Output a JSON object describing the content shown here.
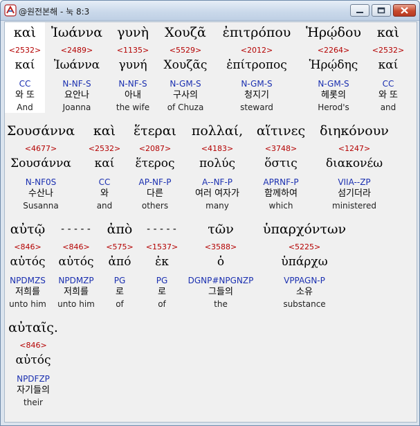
{
  "window": {
    "title": "@원전본해 - 눅 8:3"
  },
  "rows": [
    {
      "words": [
        {
          "greek": "καὶ",
          "strong": "<2532>",
          "lemma": "καί",
          "parse": "CC",
          "korean": "와 또",
          "english": "And"
        },
        {
          "greek": "Ἰωάννα",
          "strong": "<2489>",
          "lemma": "Ἰωάννα",
          "parse": "N-NF-S",
          "korean": "요안나",
          "english": "Joanna"
        },
        {
          "greek": "γυνὴ",
          "strong": "<1135>",
          "lemma": "γυνή",
          "parse": "N-NF-S",
          "korean": "아내",
          "english": "the wife"
        },
        {
          "greek": "Χουζᾶ",
          "strong": "<5529>",
          "lemma": "Χουζᾶς",
          "parse": "N-GM-S",
          "korean": "구사의",
          "english": "of Chuza"
        },
        {
          "greek": "ἐπιτρόπου",
          "strong": "<2012>",
          "lemma": "ἐπίτροπος",
          "parse": "N-GM-S",
          "korean": "청지기",
          "english": "steward"
        },
        {
          "greek": "Ἡρῴδου",
          "strong": "<2264>",
          "lemma": "Ἡρῴδης",
          "parse": "N-GM-S",
          "korean": "헤롯의",
          "english": "Herod's"
        },
        {
          "greek": "καὶ",
          "strong": "<2532>",
          "lemma": "καί",
          "parse": "CC",
          "korean": "와 또",
          "english": "and"
        }
      ]
    },
    {
      "words": [
        {
          "greek": "Σουσάννα",
          "strong": "<4677>",
          "lemma": "Σουσάννα",
          "parse": "N-NF0S",
          "korean": "수산나",
          "english": "Susanna"
        },
        {
          "greek": "καὶ",
          "strong": "<2532>",
          "lemma": "καί",
          "parse": "CC",
          "korean": "와",
          "english": "and"
        },
        {
          "greek": "ἕτεραι",
          "strong": "<2087>",
          "lemma": "ἕτερος",
          "parse": "AP-NF-P",
          "korean": "다른",
          "english": "others"
        },
        {
          "greek": "πολλαί,",
          "strong": "<4183>",
          "lemma": "πολύς",
          "parse": "A--NF-P",
          "korean": "여러 여자가",
          "english": "many"
        },
        {
          "greek": "αἵτινες",
          "strong": "<3748>",
          "lemma": "ὅστις",
          "parse": "APRNF-P",
          "korean": "함께하여",
          "english": "which"
        },
        {
          "greek": "διηκόνουν",
          "strong": "<1247>",
          "lemma": "διακονέω",
          "parse": "VIIA--ZP",
          "korean": "섬기더라",
          "english": "ministered"
        }
      ]
    },
    {
      "words": [
        {
          "greek": "αὐτῷ",
          "strong": "<846>",
          "lemma": "αὐτός",
          "parse": "NPDMZS",
          "korean": "저희를",
          "english": "unto him"
        },
        {
          "greek": "-----",
          "strong": "<846>",
          "lemma": "αὐτός",
          "parse": "NPDMZP",
          "korean": "저희를",
          "english": "unto him"
        },
        {
          "greek": "ἀπὸ",
          "strong": "<575>",
          "lemma": "ἀπό",
          "parse": "PG",
          "korean": "로",
          "english": "of"
        },
        {
          "greek": "-----",
          "strong": "<1537>",
          "lemma": "ἐκ",
          "parse": "PG",
          "korean": "로",
          "english": "of"
        },
        {
          "greek": "τῶν",
          "strong": "<3588>",
          "lemma": "ὁ",
          "parse": "DGNP#NPGNZP",
          "korean": "그들의",
          "english": "the"
        },
        {
          "greek": "ὑπαρχόντων",
          "strong": "<5225>",
          "lemma": "ὑπάρχω",
          "parse": "VPPAGN-P",
          "korean": "소유",
          "english": "substance"
        }
      ]
    },
    {
      "words": [
        {
          "greek": "αὐταῖς.",
          "strong": "<846>",
          "lemma": "αὐτός",
          "parse": "NPDFZP",
          "korean": "자기들의",
          "english": "their"
        }
      ]
    }
  ]
}
